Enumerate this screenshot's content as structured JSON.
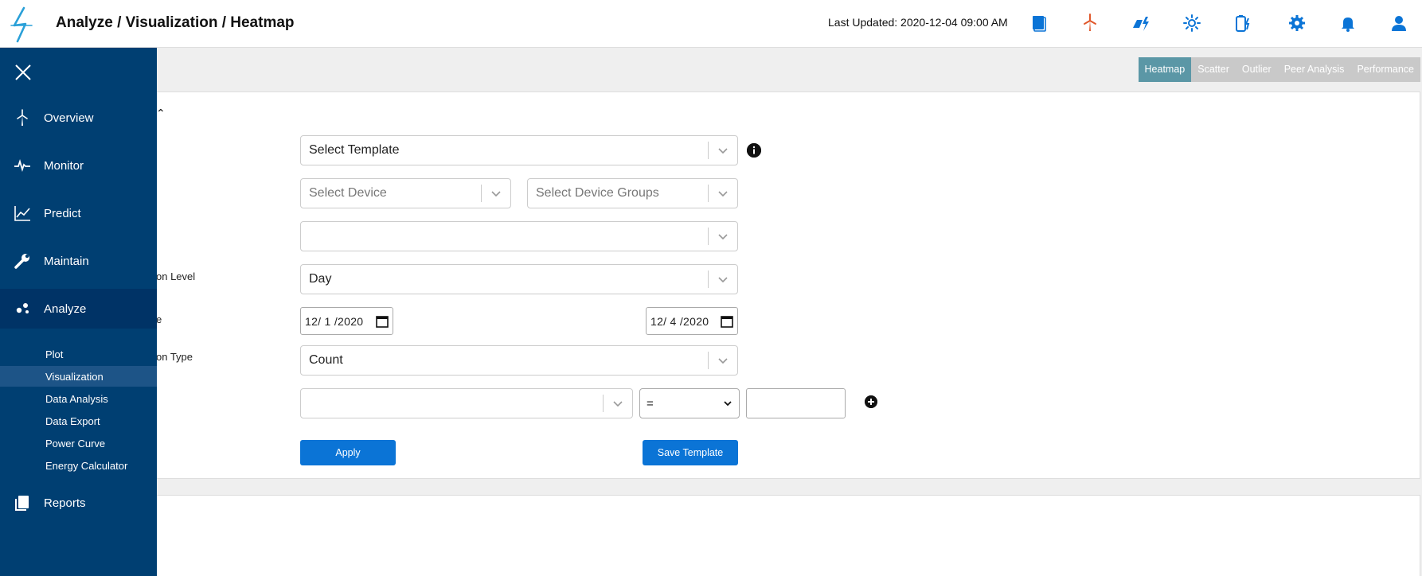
{
  "header": {
    "breadcrumb": "Analyze / Visualization / Heatmap",
    "last_updated": "Last Updated: 2020-12-04 09:00 AM",
    "icons": [
      "book-icon",
      "wind-turbine-icon",
      "solar-power-icon",
      "sun-icon",
      "battery-icon",
      "gear-icon",
      "bell-icon",
      "user-icon"
    ]
  },
  "tabs": [
    "Heatmap",
    "Scatter",
    "Outlier",
    "Peer Analysis",
    "Performance"
  ],
  "active_tab": "Heatmap",
  "form": {
    "template_placeholder": "Select Template",
    "device_placeholder": "Select Device",
    "device_groups_placeholder": "Select Device Groups",
    "aggregation_label_partial": "on Level",
    "aggregation_value": "Day",
    "date_label_partial": "e",
    "start_date": "12/ 1 /2020",
    "end_date": "12/ 4 /2020",
    "calc_type_label_partial": "on Type",
    "calc_type_value": "Count",
    "operator_value": "=",
    "apply_label": "Apply",
    "save_template_label": "Save Template"
  },
  "sidebar": {
    "items": [
      {
        "label": "Overview",
        "icon": "wind-turbine-icon"
      },
      {
        "label": "Monitor",
        "icon": "pulse-icon"
      },
      {
        "label": "Predict",
        "icon": "line-chart-icon"
      },
      {
        "label": "Maintain",
        "icon": "wrench-icon"
      },
      {
        "label": "Analyze",
        "icon": "analyze-icon"
      },
      {
        "label": "Reports",
        "icon": "reports-icon"
      }
    ],
    "sub_items": [
      "Plot",
      "Visualization",
      "Data Analysis",
      "Data Export",
      "Power Curve",
      "Energy Calculator"
    ],
    "active_sub_item": "Visualization"
  },
  "colors": {
    "sidebar_bg": "#003f72",
    "active_tab": "#5b97a6",
    "primary_button": "#0b74d6",
    "icon_blue": "#0b74d6",
    "turbine_orange": "#e0572a"
  }
}
